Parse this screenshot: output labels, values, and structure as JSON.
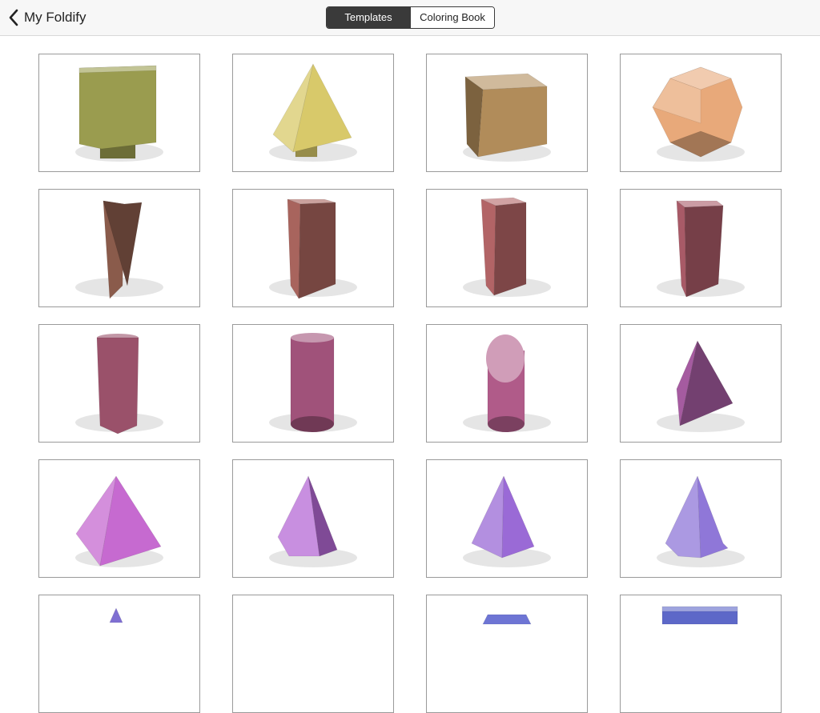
{
  "nav": {
    "back_label": "My Foldify",
    "segments": [
      "Templates",
      "Coloring Book"
    ],
    "selected_segment": "Templates"
  },
  "templates": [
    {
      "shape": "cube-on-stand",
      "color": "#9a9c4f"
    },
    {
      "shape": "tetrahedron-on-stand",
      "color": "#d8c96a"
    },
    {
      "shape": "cube",
      "color": "#b18c5a"
    },
    {
      "shape": "rhombicuboctahedron",
      "color": "#e8a97a"
    },
    {
      "shape": "triangular-prism",
      "color": "#8a5b4b"
    },
    {
      "shape": "square-prism",
      "color": "#a8645d"
    },
    {
      "shape": "pentagonal-prism",
      "color": "#b26466"
    },
    {
      "shape": "hexagonal-prism",
      "color": "#a85a67"
    },
    {
      "shape": "octagonal-prism",
      "color": "#9a516a"
    },
    {
      "shape": "cylinder",
      "color": "#a0527a"
    },
    {
      "shape": "cut-cylinder",
      "color": "#b05b89"
    },
    {
      "shape": "tetrahedron",
      "color": "#a55ba0"
    },
    {
      "shape": "square-pyramid",
      "color": "#c66ad0"
    },
    {
      "shape": "pentagonal-pyramid",
      "color": "#b66ad6"
    },
    {
      "shape": "hexagonal-pyramid",
      "color": "#9a6ad6"
    },
    {
      "shape": "octagonal-pyramid",
      "color": "#8f77d8"
    },
    {
      "shape": "small-pyramid",
      "color": "#7f6fd2"
    },
    {
      "shape": "blank",
      "color": "#7a72d0"
    },
    {
      "shape": "flat-box",
      "color": "#6e75d4"
    },
    {
      "shape": "slab",
      "color": "#5d68c8"
    }
  ]
}
